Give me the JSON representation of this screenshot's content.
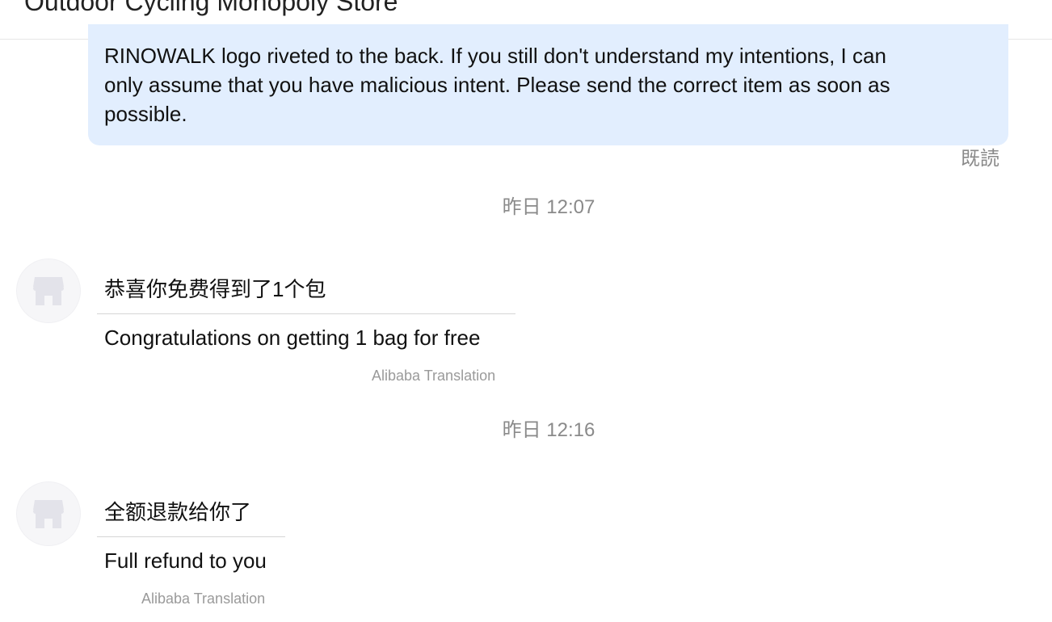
{
  "header": {
    "title": "Outdoor Cycling Monopoly Store"
  },
  "outgoing": {
    "text": "RINOWALK logo riveted to the back. If you still don't understand my intentions, I can\nonly assume that you have malicious intent. Please send the correct item as soon as\npossible.",
    "read_status": "既読",
    "bubble_color": "#e2eefe"
  },
  "messages": [
    {
      "timestamp": "昨日 12:07",
      "sender_icon": "store-icon",
      "original": "恭喜你免费得到了1个包",
      "translation": "Congratulations on getting 1 bag for free",
      "translation_source": "Alibaba Translation"
    },
    {
      "timestamp": "昨日 12:16",
      "sender_icon": "store-icon",
      "original": "全额退款给你了",
      "translation": "Full refund to you",
      "translation_source": "Alibaba Translation"
    }
  ]
}
